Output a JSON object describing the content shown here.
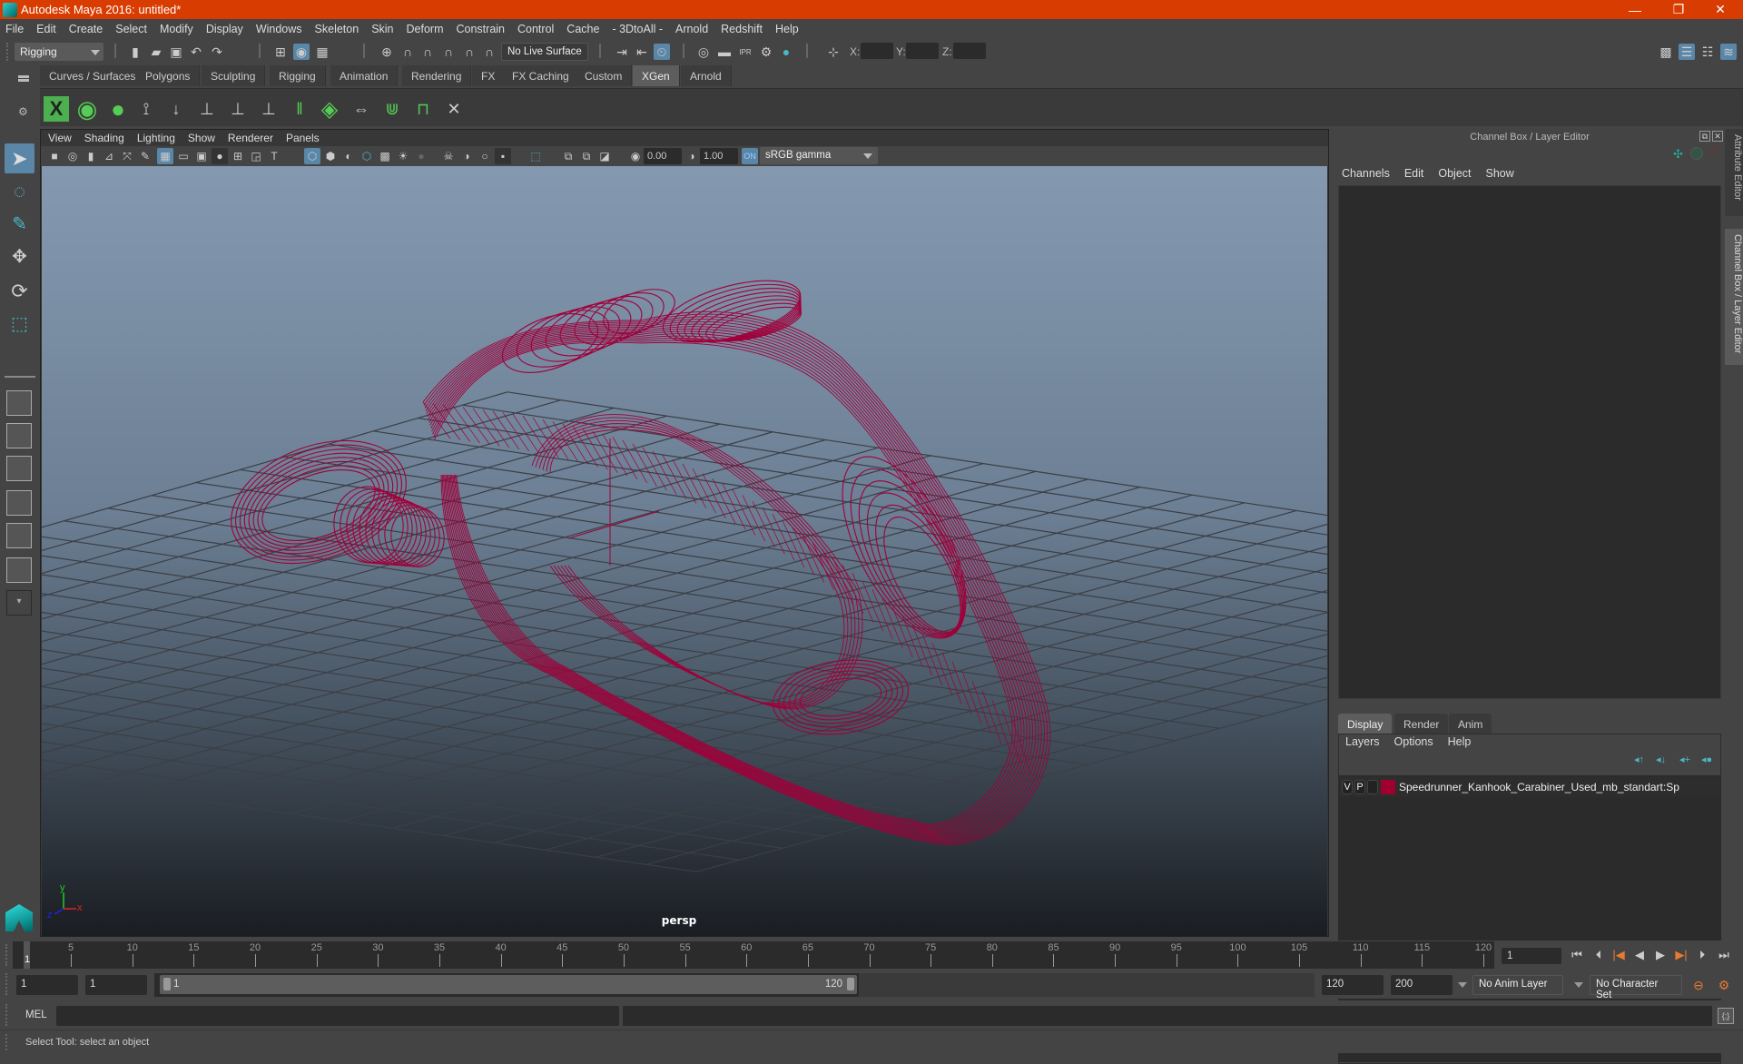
{
  "app": {
    "title": "Autodesk Maya 2016: untitled*",
    "window_controls": {
      "minimize": "—",
      "restore": "❐",
      "close": "✕"
    }
  },
  "menubar": [
    "File",
    "Edit",
    "Create",
    "Select",
    "Modify",
    "Display",
    "Windows",
    "Skeleton",
    "Skin",
    "Deform",
    "Constrain",
    "Control",
    "Cache",
    "- 3DtoAll -",
    "Arnold",
    "Redshift",
    "Help"
  ],
  "statusline": {
    "menuset": "Rigging",
    "live_surface": "No Live Surface",
    "x_label": "X:",
    "y_label": "Y:",
    "z_label": "Z:",
    "x_value": "",
    "y_value": "",
    "z_value": ""
  },
  "shelf": {
    "tabs": [
      "Curves / Surfaces",
      "Polygons",
      "Sculpting",
      "Rigging",
      "Animation",
      "Rendering",
      "FX",
      "FX Caching",
      "Custom",
      "XGen",
      "Arnold"
    ],
    "active_tab": "XGen",
    "icons": [
      "xgen-editor-icon",
      "create-description-icon",
      "toggle-visibility-icon",
      "add-guides-icon",
      "place-guides-icon",
      "add-guide-icon",
      "sculpt-guide-icon",
      "lock-guide-icon",
      "guide-to-curves-icon",
      "patch-icon",
      "flip-guides-icon",
      "select-guides-icon",
      "select-guide-tips-icon",
      "delete-guides-icon"
    ]
  },
  "toolbox": {
    "tools": [
      "select-tool-icon",
      "lasso-select-icon",
      "paint-select-icon",
      "move-tool-icon",
      "rotate-tool-icon",
      "scale-tool-icon"
    ],
    "active_tool": "select-tool-icon",
    "layouts": [
      "single-perspective-layout-icon",
      "four-view-layout-icon",
      "outliner-persp-layout-icon",
      "persp-graph-layout-icon",
      "hypershade-persp-layout-icon",
      "persp-graph-outliner-layout-icon",
      "more-layouts-icon"
    ]
  },
  "viewport": {
    "menu": [
      "View",
      "Shading",
      "Lighting",
      "Show",
      "Renderer",
      "Panels"
    ],
    "exposure": "0.00",
    "gamma": "1.00",
    "color_space": "sRGB gamma",
    "camera_label": "persp",
    "axis": {
      "x": "x",
      "y": "y",
      "z": "z"
    },
    "wire_color": "#a0003a"
  },
  "channel_box": {
    "title": "Channel Box / Layer Editor",
    "menu": [
      "Channels",
      "Edit",
      "Object",
      "Show"
    ]
  },
  "layer_editor": {
    "tabs": [
      "Display",
      "Render",
      "Anim"
    ],
    "active_tab": "Display",
    "menu": [
      "Layers",
      "Options",
      "Help"
    ],
    "layers": [
      {
        "v": "V",
        "p": "P",
        "color": "#a0002e",
        "name": "Speedrunner_Kanhook_Carabiner_Used_mb_standart:Sp"
      }
    ]
  },
  "right_tabs": [
    "Attribute Editor",
    "Channel Box / Layer Editor"
  ],
  "timeline": {
    "ticks": [
      5,
      10,
      15,
      20,
      25,
      30,
      35,
      40,
      45,
      50,
      55,
      60,
      65,
      70,
      75,
      80,
      85,
      90,
      95,
      100,
      105,
      110,
      115,
      120
    ],
    "current_frame_marker": "1",
    "current_frame": "1",
    "start": 1,
    "end": 120
  },
  "range": {
    "anim_start": "1",
    "playback_start": "1",
    "slider_start": "1",
    "slider_end": "120",
    "playback_end": "120",
    "anim_end": "200",
    "anim_layer": "No Anim Layer",
    "character_set": "No Character Set"
  },
  "command_line": {
    "language": "MEL",
    "input": "",
    "result": ""
  },
  "help_line": "Select Tool: select an object"
}
